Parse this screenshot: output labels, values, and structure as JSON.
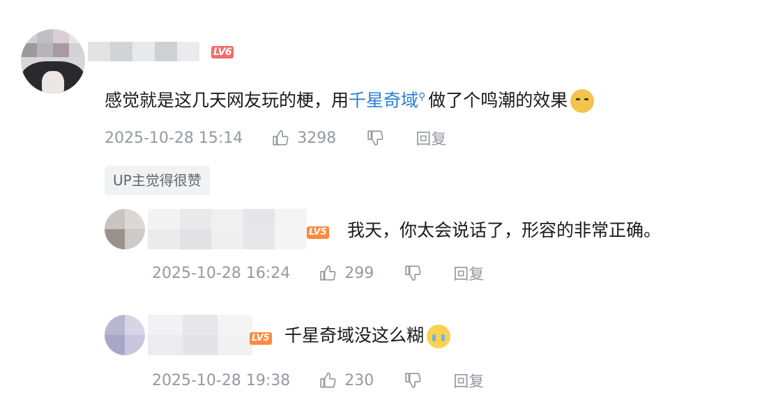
{
  "main_comment": {
    "level_badge": "LV6",
    "text_before": "感觉就是这几天网友玩的梗，用",
    "link": "千星奇域",
    "text_after": "做了个鸣潮的效果",
    "emoji": "doge-emoji",
    "time": "2025-10-28 15:14",
    "likes": "3298",
    "reply_label": "回复",
    "up_badge": "UP主觉得很赞"
  },
  "replies": [
    {
      "level_badge": "LV5",
      "text": "我天，你太会说话了，形容的非常正确。",
      "time": "2025-10-28 16:24",
      "likes": "299",
      "reply_label": "回复"
    },
    {
      "level_badge": "LV5",
      "text": "千星奇域没这么糊",
      "emoji": "cry-laugh-emoji",
      "time": "2025-10-28 19:38",
      "likes": "230",
      "reply_label": "回复"
    }
  ],
  "colors": {
    "link": "#2a7fd4",
    "meta": "#9499a0",
    "lv6": "#f26c6c",
    "lv5": "#ff8b3d"
  }
}
